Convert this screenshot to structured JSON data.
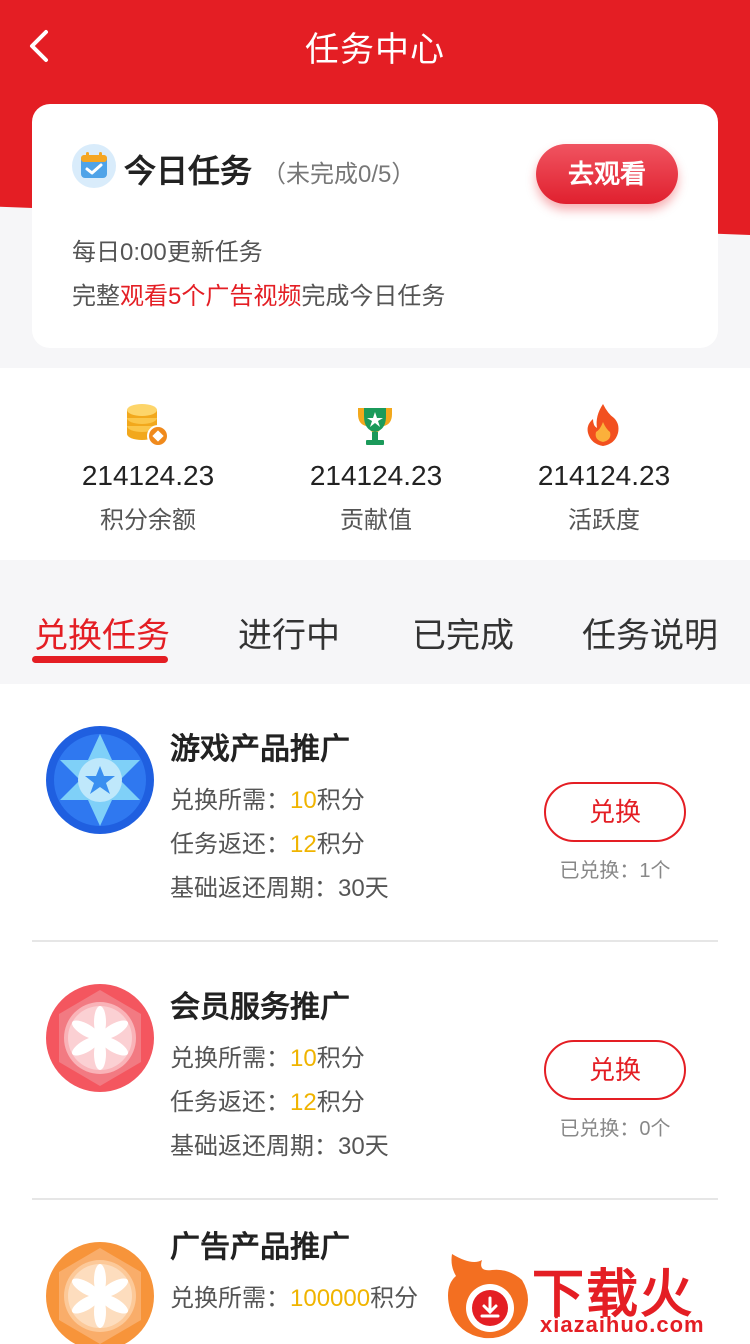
{
  "header": {
    "title": "任务中心"
  },
  "today_task": {
    "title": "今日任务",
    "progress": "（未完成0/5）",
    "button": "去观看",
    "line1": "每日0:00更新任务",
    "line2_pre": "完整",
    "line2_highlight": "观看5个广告视频",
    "line2_post": "完成今日任务"
  },
  "stats": [
    {
      "value": "214124.23",
      "label": "积分余额",
      "icon": "coins-icon"
    },
    {
      "value": "214124.23",
      "label": "贡献值",
      "icon": "trophy-icon"
    },
    {
      "value": "214124.23",
      "label": "活跃度",
      "icon": "flame-icon"
    }
  ],
  "tabs": [
    {
      "label": "兑换任务",
      "active": true
    },
    {
      "label": "进行中",
      "active": false
    },
    {
      "label": "已完成",
      "active": false
    },
    {
      "label": "任务说明",
      "active": false
    }
  ],
  "items": [
    {
      "name": "游戏产品推广",
      "cost_label": "兑换所需：",
      "cost_value": "10",
      "cost_unit": "积分",
      "return_label": "任务返还：",
      "return_value": "12",
      "return_unit": "积分",
      "period": "基础返还周期：30天",
      "button": "兑换",
      "exchanged": "已兑换：1个",
      "icon": "blue-star-badge-icon"
    },
    {
      "name": "会员服务推广",
      "cost_label": "兑换所需：",
      "cost_value": "10",
      "cost_unit": "积分",
      "return_label": "任务返还：",
      "return_value": "12",
      "return_unit": "积分",
      "period": "基础返还周期：30天",
      "button": "兑换",
      "exchanged": "已兑换：0个",
      "icon": "red-flower-badge-icon"
    },
    {
      "name": "广告产品推广",
      "cost_label": "兑换所需：",
      "cost_value": "100000",
      "cost_unit": "积分",
      "icon": "orange-flower-badge-icon"
    }
  ],
  "watermark": {
    "text": "下载火",
    "url": "xiazaihuo.com"
  },
  "colors": {
    "brand": "#e41e24",
    "highlight_number": "#f0b400"
  }
}
